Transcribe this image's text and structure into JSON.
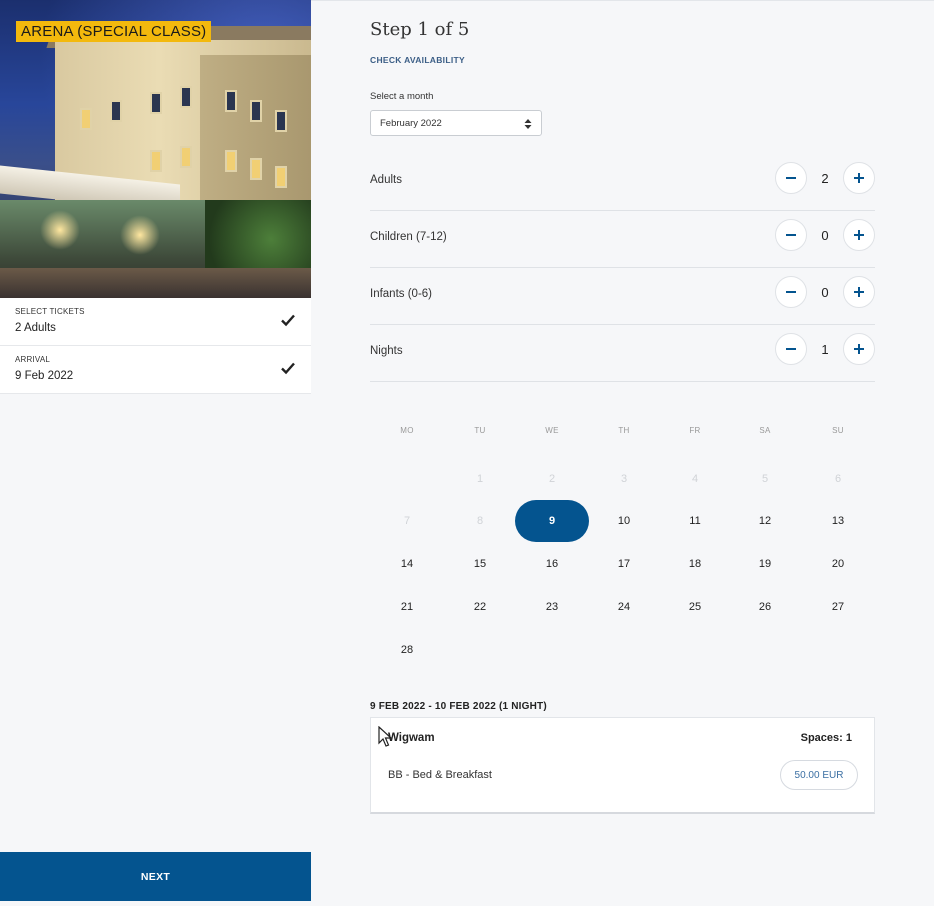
{
  "hero": {
    "badge": "ARENA (SPECIAL CLASS)"
  },
  "summary": [
    {
      "label": "SELECT TICKETS",
      "value": "2 Adults",
      "icon": "check-icon"
    },
    {
      "label": "ARRIVAL",
      "value": "9 Feb 2022",
      "icon": "check-icon"
    }
  ],
  "next_label": "NEXT",
  "step": {
    "title": "Step 1 of 5",
    "subtitle": "CHECK AVAILABILITY"
  },
  "month": {
    "label": "Select a month",
    "selected": "February 2022"
  },
  "counters": [
    {
      "name": "Adults",
      "count": "2"
    },
    {
      "name": "Children (7-12)",
      "count": "0"
    },
    {
      "name": "Infants (0-6)",
      "count": "0"
    },
    {
      "name": "Nights",
      "count": "1"
    }
  ],
  "calendar": {
    "weekdays": [
      "MO",
      "TU",
      "WE",
      "TH",
      "FR",
      "SA",
      "SU"
    ],
    "rows": [
      [
        "",
        "1",
        "2",
        "3",
        "4",
        "5",
        "6"
      ],
      [
        "7",
        "8",
        "9",
        "10",
        "11",
        "12",
        "13"
      ],
      [
        "14",
        "15",
        "16",
        "17",
        "18",
        "19",
        "20"
      ],
      [
        "21",
        "22",
        "23",
        "24",
        "25",
        "26",
        "27"
      ],
      [
        "28",
        "",
        "",
        "",
        "",
        "",
        ""
      ]
    ],
    "muted": [
      "1",
      "2",
      "3",
      "4",
      "5",
      "6",
      "7",
      "8"
    ],
    "selected": "9"
  },
  "range_label": "9 FEB 2022 - 10 FEB 2022 (1 NIGHT)",
  "room": {
    "name": "Wigwam",
    "spaces": "Spaces: 1",
    "board": "BB - Bed & Breakfast",
    "price": "50.00 EUR"
  },
  "colors": {
    "primary": "#04548f",
    "badge": "#f3b90d"
  }
}
